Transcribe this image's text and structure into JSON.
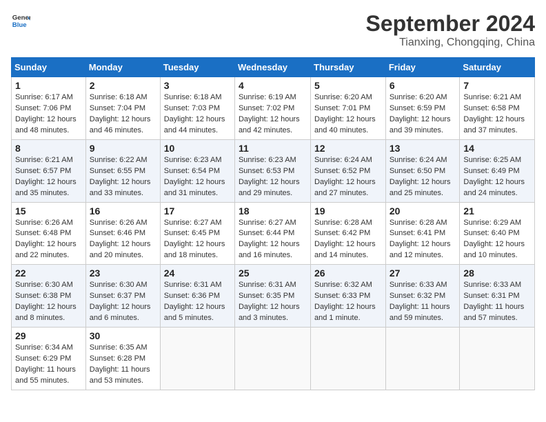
{
  "header": {
    "logo_line1": "General",
    "logo_line2": "Blue",
    "month": "September 2024",
    "location": "Tianxing, Chongqing, China"
  },
  "weekdays": [
    "Sunday",
    "Monday",
    "Tuesday",
    "Wednesday",
    "Thursday",
    "Friday",
    "Saturday"
  ],
  "weeks": [
    [
      {
        "day": "1",
        "sunrise": "6:17 AM",
        "sunset": "7:06 PM",
        "daylight": "12 hours and 48 minutes."
      },
      {
        "day": "2",
        "sunrise": "6:18 AM",
        "sunset": "7:04 PM",
        "daylight": "12 hours and 46 minutes."
      },
      {
        "day": "3",
        "sunrise": "6:18 AM",
        "sunset": "7:03 PM",
        "daylight": "12 hours and 44 minutes."
      },
      {
        "day": "4",
        "sunrise": "6:19 AM",
        "sunset": "7:02 PM",
        "daylight": "12 hours and 42 minutes."
      },
      {
        "day": "5",
        "sunrise": "6:20 AM",
        "sunset": "7:01 PM",
        "daylight": "12 hours and 40 minutes."
      },
      {
        "day": "6",
        "sunrise": "6:20 AM",
        "sunset": "6:59 PM",
        "daylight": "12 hours and 39 minutes."
      },
      {
        "day": "7",
        "sunrise": "6:21 AM",
        "sunset": "6:58 PM",
        "daylight": "12 hours and 37 minutes."
      }
    ],
    [
      {
        "day": "8",
        "sunrise": "6:21 AM",
        "sunset": "6:57 PM",
        "daylight": "12 hours and 35 minutes."
      },
      {
        "day": "9",
        "sunrise": "6:22 AM",
        "sunset": "6:55 PM",
        "daylight": "12 hours and 33 minutes."
      },
      {
        "day": "10",
        "sunrise": "6:23 AM",
        "sunset": "6:54 PM",
        "daylight": "12 hours and 31 minutes."
      },
      {
        "day": "11",
        "sunrise": "6:23 AM",
        "sunset": "6:53 PM",
        "daylight": "12 hours and 29 minutes."
      },
      {
        "day": "12",
        "sunrise": "6:24 AM",
        "sunset": "6:52 PM",
        "daylight": "12 hours and 27 minutes."
      },
      {
        "day": "13",
        "sunrise": "6:24 AM",
        "sunset": "6:50 PM",
        "daylight": "12 hours and 25 minutes."
      },
      {
        "day": "14",
        "sunrise": "6:25 AM",
        "sunset": "6:49 PM",
        "daylight": "12 hours and 24 minutes."
      }
    ],
    [
      {
        "day": "15",
        "sunrise": "6:26 AM",
        "sunset": "6:48 PM",
        "daylight": "12 hours and 22 minutes."
      },
      {
        "day": "16",
        "sunrise": "6:26 AM",
        "sunset": "6:46 PM",
        "daylight": "12 hours and 20 minutes."
      },
      {
        "day": "17",
        "sunrise": "6:27 AM",
        "sunset": "6:45 PM",
        "daylight": "12 hours and 18 minutes."
      },
      {
        "day": "18",
        "sunrise": "6:27 AM",
        "sunset": "6:44 PM",
        "daylight": "12 hours and 16 minutes."
      },
      {
        "day": "19",
        "sunrise": "6:28 AM",
        "sunset": "6:42 PM",
        "daylight": "12 hours and 14 minutes."
      },
      {
        "day": "20",
        "sunrise": "6:28 AM",
        "sunset": "6:41 PM",
        "daylight": "12 hours and 12 minutes."
      },
      {
        "day": "21",
        "sunrise": "6:29 AM",
        "sunset": "6:40 PM",
        "daylight": "12 hours and 10 minutes."
      }
    ],
    [
      {
        "day": "22",
        "sunrise": "6:30 AM",
        "sunset": "6:38 PM",
        "daylight": "12 hours and 8 minutes."
      },
      {
        "day": "23",
        "sunrise": "6:30 AM",
        "sunset": "6:37 PM",
        "daylight": "12 hours and 6 minutes."
      },
      {
        "day": "24",
        "sunrise": "6:31 AM",
        "sunset": "6:36 PM",
        "daylight": "12 hours and 5 minutes."
      },
      {
        "day": "25",
        "sunrise": "6:31 AM",
        "sunset": "6:35 PM",
        "daylight": "12 hours and 3 minutes."
      },
      {
        "day": "26",
        "sunrise": "6:32 AM",
        "sunset": "6:33 PM",
        "daylight": "12 hours and 1 minute."
      },
      {
        "day": "27",
        "sunrise": "6:33 AM",
        "sunset": "6:32 PM",
        "daylight": "11 hours and 59 minutes."
      },
      {
        "day": "28",
        "sunrise": "6:33 AM",
        "sunset": "6:31 PM",
        "daylight": "11 hours and 57 minutes."
      }
    ],
    [
      {
        "day": "29",
        "sunrise": "6:34 AM",
        "sunset": "6:29 PM",
        "daylight": "11 hours and 55 minutes."
      },
      {
        "day": "30",
        "sunrise": "6:35 AM",
        "sunset": "6:28 PM",
        "daylight": "11 hours and 53 minutes."
      },
      null,
      null,
      null,
      null,
      null
    ]
  ]
}
